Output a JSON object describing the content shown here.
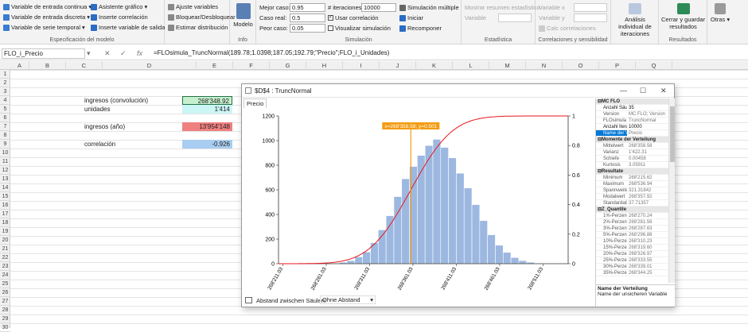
{
  "ribbon": {
    "model": {
      "label": "Especificación del modelo",
      "items": [
        "Variable de entrada continua",
        "Variable de entrada discreta",
        "Variable de serie temporal",
        "Asistente gráfico",
        "Inserte correlación",
        "Inserte variable de salida",
        "Ajuste variables",
        "Bloquear/Desbloquear",
        "Estimar distribución"
      ]
    },
    "info": {
      "label": "Info",
      "modelo": "Modelo"
    },
    "sim": {
      "label": "Simulación",
      "mejor": "Mejor caso:",
      "mejor_v": "0.95",
      "real": "Caso real:",
      "real_v": "0.5",
      "peor": "Peor caso:",
      "peor_v": "0.05",
      "iter": "# iteraciones:",
      "iter_v": "10000",
      "usar": "Usar correlación",
      "visual": "Visualizar simulación",
      "multiple": "Simulación múltiple",
      "iniciar": "Iniciar",
      "recomponer": "Recomponer"
    },
    "est": {
      "label": "Estadística",
      "mostrar": "Mostrar resumen estadístico",
      "variable": "Variable"
    },
    "corr": {
      "label": "Correlaciones y sensibilidad",
      "vx": "Variable x",
      "vy": "Variable y",
      "calc": "Calc correlaciones"
    },
    "res": {
      "label": "Resultados",
      "analisis": "Análisis individual de iteraciones",
      "cerrar": "Cerrar y guardar resultados"
    },
    "otras": {
      "label": "Otras"
    }
  },
  "formula": {
    "name": "FLO_i_Precio",
    "fx": "fx",
    "text": "=FLOsimula_TruncNormal(189.78;1.0398;187.05;192.79;\"Precio\";FLO_i_Unidades)"
  },
  "columns": [
    "A",
    "B",
    "C",
    "D",
    "E",
    "F",
    "G",
    "H",
    "I",
    "J",
    "K",
    "L",
    "M",
    "N",
    "O",
    "P",
    "Q"
  ],
  "rows": [
    "1",
    "2",
    "3",
    "4",
    "5",
    "6",
    "7",
    "8",
    "9",
    "10",
    "11",
    "12",
    "13",
    "14",
    "15",
    "16",
    "17",
    "18",
    "19",
    "20",
    "21",
    "22",
    "23",
    "24",
    "25",
    "26",
    "27",
    "28",
    "29",
    "30"
  ],
  "cells": {
    "l1": "ingresos (convolución)",
    "v1": "268'348.92",
    "l2": "unidades",
    "v2": "1'414",
    "l3": "ingresos (año)",
    "v3": "13'954'148",
    "l4": "correlación",
    "v4": "-0.926"
  },
  "colors": {
    "v1": "#c6efce",
    "v2": "#ccf5f5",
    "v3": "#f08080",
    "v4": "#a9cdf0",
    "bars": "#9db8e0",
    "cdf": "#e8161c",
    "marker": "#f39c12"
  },
  "window": {
    "title": "$D$4 : TruncNormal",
    "tab": "Precio",
    "gap_label": "Abstand zwischen Säulen:",
    "gap_value": "Ohne Abstand"
  },
  "panel": {
    "rows": [
      {
        "t": "cat",
        "k": "MC FLO",
        "v": ""
      },
      {
        "t": "b",
        "k": "Anzahl Säule",
        "v": "35"
      },
      {
        "t": "",
        "k": "Version",
        "v": "MC FLO; Version"
      },
      {
        "t": "",
        "k": "FLOsimula",
        "v": "TruncNormal"
      },
      {
        "t": "b",
        "k": "Anzahl Iterati",
        "v": "10000"
      },
      {
        "t": "sel",
        "k": "Name der Ve",
        "v": "Precio"
      },
      {
        "t": "cat",
        "k": "Momente der Verteilung",
        "v": ""
      },
      {
        "t": "",
        "k": "Mittelwert",
        "v": "268'358.58"
      },
      {
        "t": "",
        "k": "Varianz",
        "v": "1'422.31"
      },
      {
        "t": "",
        "k": "Schiefe",
        "v": "0.00458"
      },
      {
        "t": "",
        "k": "Kurtosis",
        "v": "3.05911"
      },
      {
        "t": "cat",
        "k": "Resultate",
        "v": ""
      },
      {
        "t": "",
        "k": "Minimum",
        "v": "268'215.62"
      },
      {
        "t": "",
        "k": "Maximum",
        "v": "268'536.94"
      },
      {
        "t": "",
        "k": "Spannweite",
        "v": "321.31842"
      },
      {
        "t": "",
        "k": "Modalwert",
        "v": "268'357.92"
      },
      {
        "t": "",
        "k": "Standardabw",
        "v": "37.71357"
      },
      {
        "t": "cat",
        "k": "Z_Quantile",
        "v": ""
      },
      {
        "t": "",
        "k": "1%-Perzentil",
        "v": "268'270.24"
      },
      {
        "t": "",
        "k": "2%-Perzentil",
        "v": "268'281.56"
      },
      {
        "t": "",
        "k": "3%-Perzentil",
        "v": "268'287.63"
      },
      {
        "t": "",
        "k": "5%-Perzentil",
        "v": "268'296.88"
      },
      {
        "t": "",
        "k": "10%-Perzentil",
        "v": "268'310.23"
      },
      {
        "t": "",
        "k": "15%-Perzentil",
        "v": "268'319.60"
      },
      {
        "t": "",
        "k": "20%-Perzentil",
        "v": "268'326.97"
      },
      {
        "t": "",
        "k": "25%-Perzentil",
        "v": "268'333.55"
      },
      {
        "t": "",
        "k": "30%-Perzentil",
        "v": "268'339.01"
      },
      {
        "t": "",
        "k": "35%-Perzentil",
        "v": "268'344.25"
      }
    ],
    "desc_title": "Name der Verteilung",
    "desc_text": "Name der unsicheren Variable"
  },
  "chart_data": {
    "type": "bar",
    "x": [
      268213,
      268222,
      268231,
      268240,
      268249,
      268258,
      268267,
      268276,
      268285,
      268294,
      268303,
      268312,
      268321,
      268330,
      268339,
      268348,
      268357,
      268366,
      268375,
      268384,
      268393,
      268402,
      268411,
      268420,
      268429,
      268438,
      268447,
      268456,
      268465,
      268474,
      268483,
      268492,
      268501,
      268510,
      268519
    ],
    "values": [
      0,
      0,
      0,
      0,
      0,
      2,
      5,
      12,
      25,
      55,
      95,
      170,
      275,
      390,
      545,
      690,
      790,
      880,
      960,
      1010,
      945,
      860,
      735,
      615,
      480,
      350,
      235,
      150,
      92,
      50,
      25,
      12,
      5,
      2,
      0
    ],
    "xticks": [
      "268'211.03",
      "268'261.03",
      "268'311.03",
      "268'361.03",
      "268'411.03",
      "268'461.03",
      "268'511.03"
    ],
    "xtick_values": [
      268211.03,
      268261.03,
      268311.03,
      268361.03,
      268411.03,
      268461.03,
      268511.03
    ],
    "xlim": [
      268206,
      268540
    ],
    "ylim": [
      0,
      1200
    ],
    "yticks": [
      0,
      200,
      400,
      600,
      800,
      1000,
      1200
    ],
    "y2ticks": [
      0,
      0.2,
      0.4,
      0.6,
      0.8,
      1
    ],
    "cdf_mean": 268358.58,
    "cdf_sd": 37.71357,
    "marker": {
      "x": 268358.58,
      "label": "x=268'358.58; y=0.501"
    }
  }
}
